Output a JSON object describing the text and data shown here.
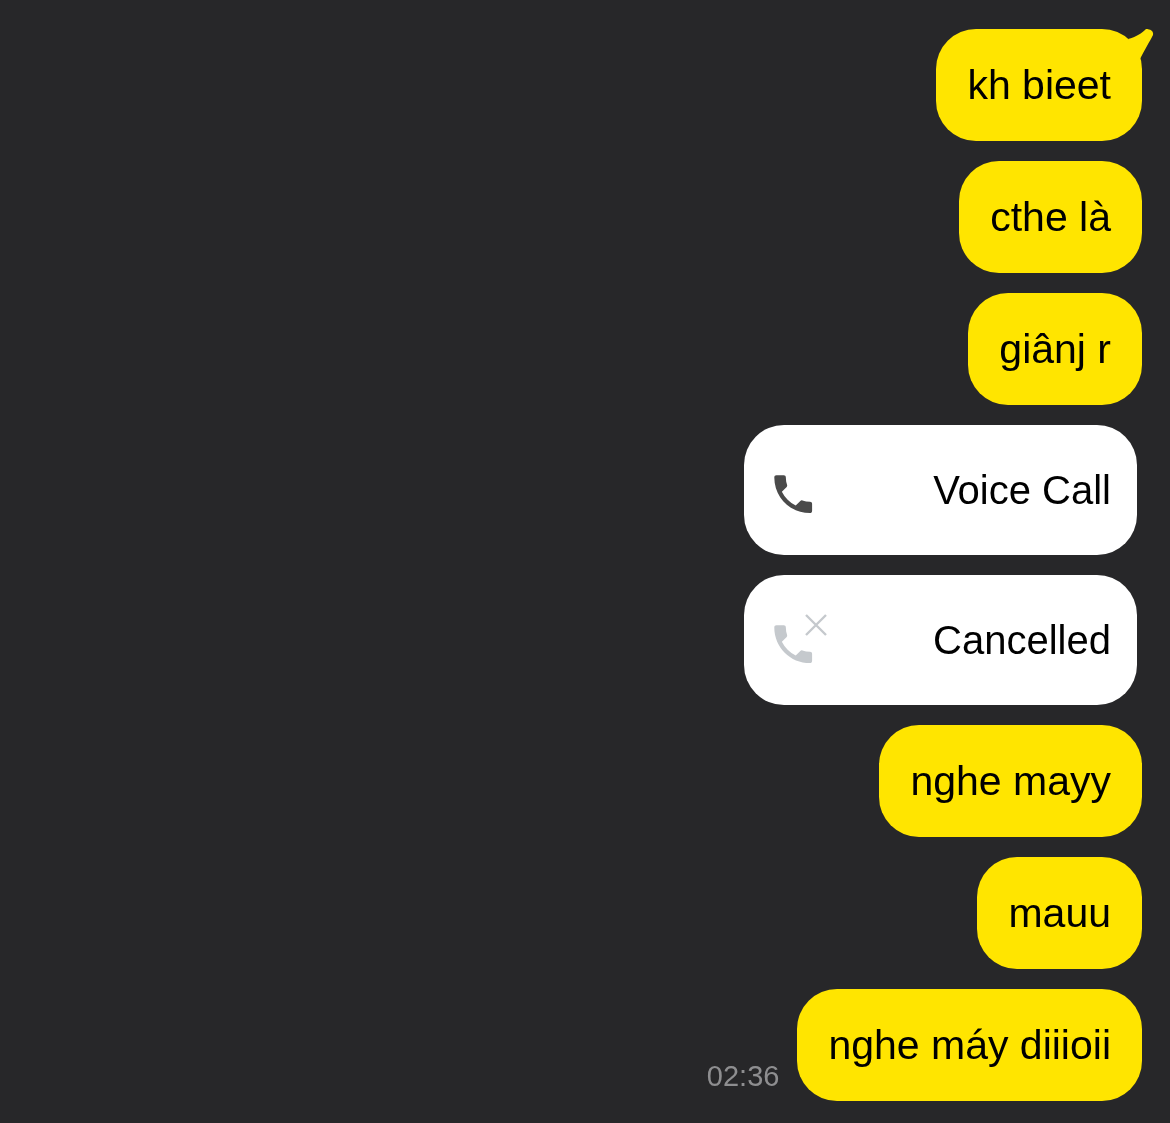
{
  "messages": [
    {
      "kind": "text",
      "text": "kh bieet",
      "tail": true
    },
    {
      "kind": "text",
      "text": "cthe là",
      "tail": false
    },
    {
      "kind": "text",
      "text": "giânj r",
      "tail": false
    },
    {
      "kind": "call",
      "text": "Voice Call",
      "cancelled": false
    },
    {
      "kind": "call",
      "text": "Cancelled",
      "cancelled": true
    },
    {
      "kind": "text",
      "text": "nghe mayy",
      "tail": false
    },
    {
      "kind": "text",
      "text": "mauu",
      "tail": false
    },
    {
      "kind": "text",
      "text": "nghe máy diiioii",
      "tail": false,
      "time": "02:36"
    }
  ]
}
